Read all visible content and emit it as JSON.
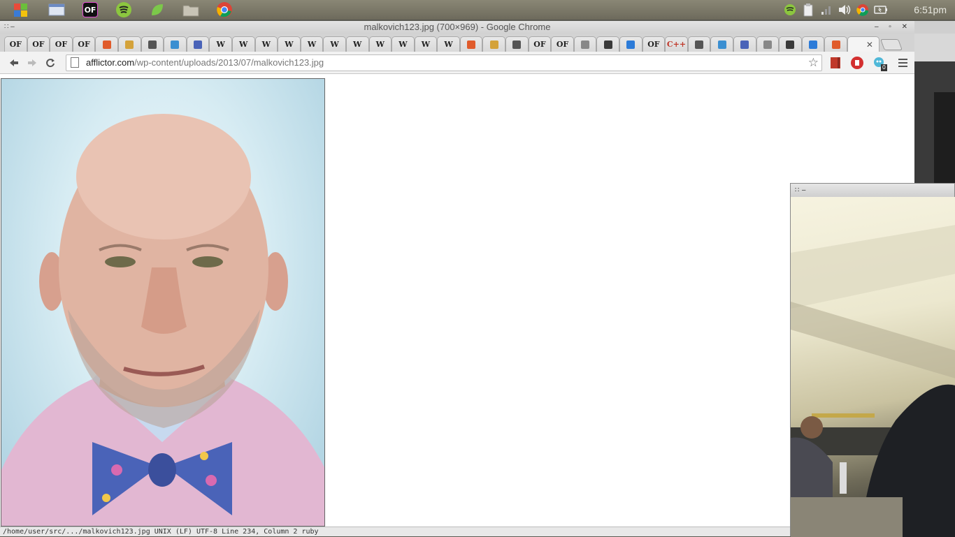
{
  "panel": {
    "launchers": [
      {
        "name": "applications-menu",
        "color": "#e9a23a"
      },
      {
        "name": "file-manager-window",
        "color": "#7d9ecf"
      },
      {
        "name": "media-app",
        "color": "#1a1a1a"
      },
      {
        "name": "spotify",
        "color": "#2bb34a"
      },
      {
        "name": "leaf-app",
        "color": "#6cc04a"
      },
      {
        "name": "folder",
        "color": "#b6b2a4"
      },
      {
        "name": "chrome",
        "color": "#d84a38"
      }
    ],
    "clock": "6:51pm"
  },
  "window": {
    "title": "malkovich123.jpg (700×969) - Google Chrome"
  },
  "tabs": [
    {
      "label": "OF"
    },
    {
      "label": "OF"
    },
    {
      "label": "OF"
    },
    {
      "label": "OF"
    },
    {
      "label": ""
    },
    {
      "label": ""
    },
    {
      "label": ""
    },
    {
      "label": ""
    },
    {
      "label": ""
    },
    {
      "label": "W"
    },
    {
      "label": "W"
    },
    {
      "label": "W"
    },
    {
      "label": "W"
    },
    {
      "label": "W"
    },
    {
      "label": "W"
    },
    {
      "label": "W"
    },
    {
      "label": "W"
    },
    {
      "label": "W"
    },
    {
      "label": "W"
    },
    {
      "label": "W"
    },
    {
      "label": ""
    },
    {
      "label": ""
    },
    {
      "label": ""
    },
    {
      "label": "OF"
    },
    {
      "label": "OF"
    },
    {
      "label": ""
    },
    {
      "label": ""
    },
    {
      "label": ""
    },
    {
      "label": "OF"
    },
    {
      "label": "C++"
    },
    {
      "label": ""
    },
    {
      "label": ""
    },
    {
      "label": ""
    },
    {
      "label": ""
    },
    {
      "label": ""
    },
    {
      "label": ""
    },
    {
      "label": ""
    }
  ],
  "toolbar": {
    "url_domain": "afflictor.com",
    "url_path": "/wp-content/uploads/2013/07/malkovich123.jpg",
    "badge_count": "0"
  },
  "statusbar": {
    "text": "/home/user/src/.../malkovich123.jpg   UNIX (LF)   UTF-8   Line 234, Column 2   ruby"
  }
}
